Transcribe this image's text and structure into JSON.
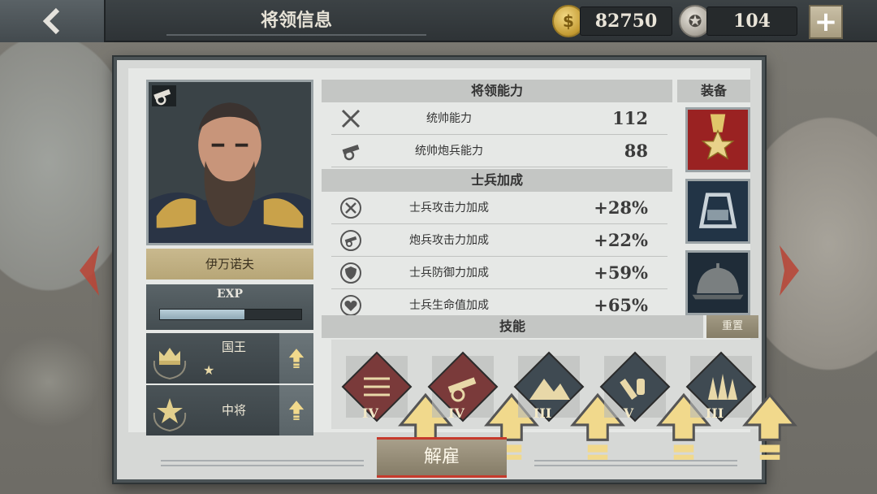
{
  "header": {
    "title": "将领信息",
    "gold": "82750",
    "medals": "104",
    "back_icon": "chevron-left-icon",
    "add_icon": "plus-icon"
  },
  "general": {
    "name": "伊万诺夫",
    "exp_label": "EXP",
    "exp_progress": 0.6,
    "type_icon": "cannon-icon"
  },
  "ranks": [
    {
      "title": "国王",
      "stars": "★"
    },
    {
      "title": "中将",
      "stars": ""
    }
  ],
  "ability": {
    "header": "将领能力",
    "stats": [
      {
        "icon": "crossed-swords-icon",
        "label": "统帅能力",
        "value": "112"
      },
      {
        "icon": "cannon-icon",
        "label": "统帅炮兵能力",
        "value": "88"
      }
    ]
  },
  "bonus": {
    "header": "士兵加成",
    "stats": [
      {
        "icon": "attack-up-icon",
        "label": "士兵攻击力加成",
        "value": "+28%"
      },
      {
        "icon": "artillery-up-icon",
        "label": "炮兵攻击力加成",
        "value": "+22%"
      },
      {
        "icon": "defense-up-icon",
        "label": "士兵防御力加成",
        "value": "+59%"
      },
      {
        "icon": "health-up-icon",
        "label": "士兵生命值加成",
        "value": "+65%"
      }
    ]
  },
  "equipment": {
    "header": "装备",
    "items": [
      "medal-icon",
      "epaulette-icon",
      "helmet-icon"
    ]
  },
  "skills": {
    "header": "技能",
    "reset_label": "重置",
    "items": [
      {
        "icon": "arrows-volley-icon",
        "level": "IV",
        "color": "#7a3a3a"
      },
      {
        "icon": "artillery-cannon-icon",
        "level": "IV",
        "color": "#7a3a3a"
      },
      {
        "icon": "mountains-icon",
        "level": "III",
        "color": "#3f4a52"
      },
      {
        "icon": "supply-tools-icon",
        "level": "V",
        "color": "#3f4a52"
      },
      {
        "icon": "forest-icon",
        "level": "III",
        "color": "#3f4a52"
      }
    ]
  },
  "actions": {
    "dismiss_label": "解雇"
  }
}
